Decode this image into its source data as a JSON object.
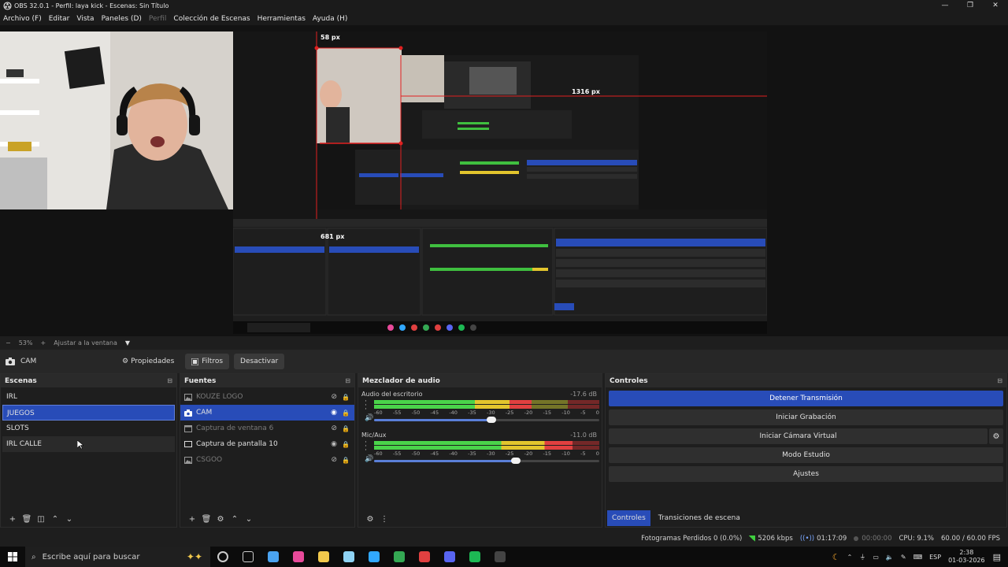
{
  "window": {
    "title": "OBS 32.0.1 - Perfil: laya kick - Escenas: Sin Título",
    "minimize": "—",
    "restore": "❐",
    "close": "✕"
  },
  "menu": [
    {
      "label": "Archivo (F)",
      "enabled": true
    },
    {
      "label": "Editar",
      "enabled": true
    },
    {
      "label": "Vista",
      "enabled": true
    },
    {
      "label": "Paneles (D)",
      "enabled": true
    },
    {
      "label": "Perfil",
      "enabled": false
    },
    {
      "label": "Colección de Escenas",
      "enabled": true
    },
    {
      "label": "Herramientas",
      "enabled": true
    },
    {
      "label": "Ayuda (H)",
      "enabled": true
    }
  ],
  "preview": {
    "overlay_label_1": "58 px",
    "overlay_label_2": "1316 px",
    "overlay_label_3": "681 px"
  },
  "zoom": {
    "minus": "−",
    "value": "53%",
    "plus": "+",
    "fit_label": "Ajustar a la ventana",
    "dropdown_icon": "▼"
  },
  "context_bar": {
    "source_name": "CAM",
    "properties_label": "Propiedades",
    "filters_label": "Filtros",
    "deactivate_label": "Desactivar"
  },
  "scenes": {
    "title": "Escenas",
    "selected_index": 1,
    "items": [
      "IRL",
      "JUEGOS",
      "SLOTS",
      "IRL CALLE"
    ]
  },
  "sources": {
    "title": "Fuentes",
    "items": [
      {
        "label": "KOUZE LOGO",
        "icon": "image-icon",
        "visible": false,
        "locked": true,
        "selected": false
      },
      {
        "label": "CAM",
        "icon": "camera-icon",
        "visible": true,
        "locked": true,
        "selected": true
      },
      {
        "label": "Captura de ventana 6",
        "icon": "window-capture-icon",
        "visible": false,
        "locked": true,
        "selected": false
      },
      {
        "label": "Captura de pantalla 10",
        "icon": "display-capture-icon",
        "visible": true,
        "locked": true,
        "selected": false
      },
      {
        "label": "CSGOO",
        "icon": "image-icon",
        "visible": false,
        "locked": true,
        "selected": false
      }
    ]
  },
  "mixer": {
    "title": "Mezclador de audio",
    "scale": [
      "-60",
      "-55",
      "-50",
      "-45",
      "-40",
      "-35",
      "-30",
      "-25",
      "-20",
      "-15",
      "-10",
      "-5",
      "0"
    ],
    "channels": [
      {
        "name": "Audio del escritorio",
        "db": "-17.6 dB",
        "level": 0.7,
        "volume": 0.52
      },
      {
        "name": "Mic/Aux",
        "db": "-11.0 dB",
        "level": 0.88,
        "volume": 0.63
      }
    ]
  },
  "controls": {
    "title": "Controles",
    "buttons": [
      {
        "label": "Detener Transmisión",
        "primary": true
      },
      {
        "label": "Iniciar Grabación",
        "primary": false
      },
      {
        "label": "Iniciar Cámara Virtual",
        "primary": false
      },
      {
        "label": "Modo Estudio",
        "primary": false
      },
      {
        "label": "Ajustes",
        "primary": false
      }
    ],
    "tabs": [
      "Controles",
      "Transiciones de escena"
    ]
  },
  "status": {
    "dropped_frames": "Fotogramas Perdidos 0 (0.0%)",
    "bitrate": "5206 kbps",
    "stream_time": "01:17:09",
    "record_time": "00:00:00",
    "cpu": "CPU: 9.1%",
    "fps": "60.00 / 60.00 FPS"
  },
  "taskbar": {
    "search_placeholder": "Escribe aquí para buscar",
    "language": "ESP",
    "time": "2:38",
    "date": "01-03-2026",
    "apps": [
      {
        "name": "cortana-icon",
        "color": "#cccccc"
      },
      {
        "name": "task-view-icon",
        "color": "#cccccc"
      },
      {
        "name": "copilot-icon",
        "color": "#4aa3f0"
      },
      {
        "name": "app-pink-icon",
        "color": "#e84a9a"
      },
      {
        "name": "file-explorer-icon",
        "color": "#f2c94c"
      },
      {
        "name": "notepad-icon",
        "color": "#8fd3f4"
      },
      {
        "name": "photoshop-icon",
        "color": "#31a8ff"
      },
      {
        "name": "chrome-icon",
        "color": "#34a853"
      },
      {
        "name": "app-red-icon",
        "color": "#e04040"
      },
      {
        "name": "discord-icon",
        "color": "#5865f2"
      },
      {
        "name": "spotify-icon",
        "color": "#1db954"
      },
      {
        "name": "obs-icon",
        "color": "#444444"
      }
    ]
  }
}
